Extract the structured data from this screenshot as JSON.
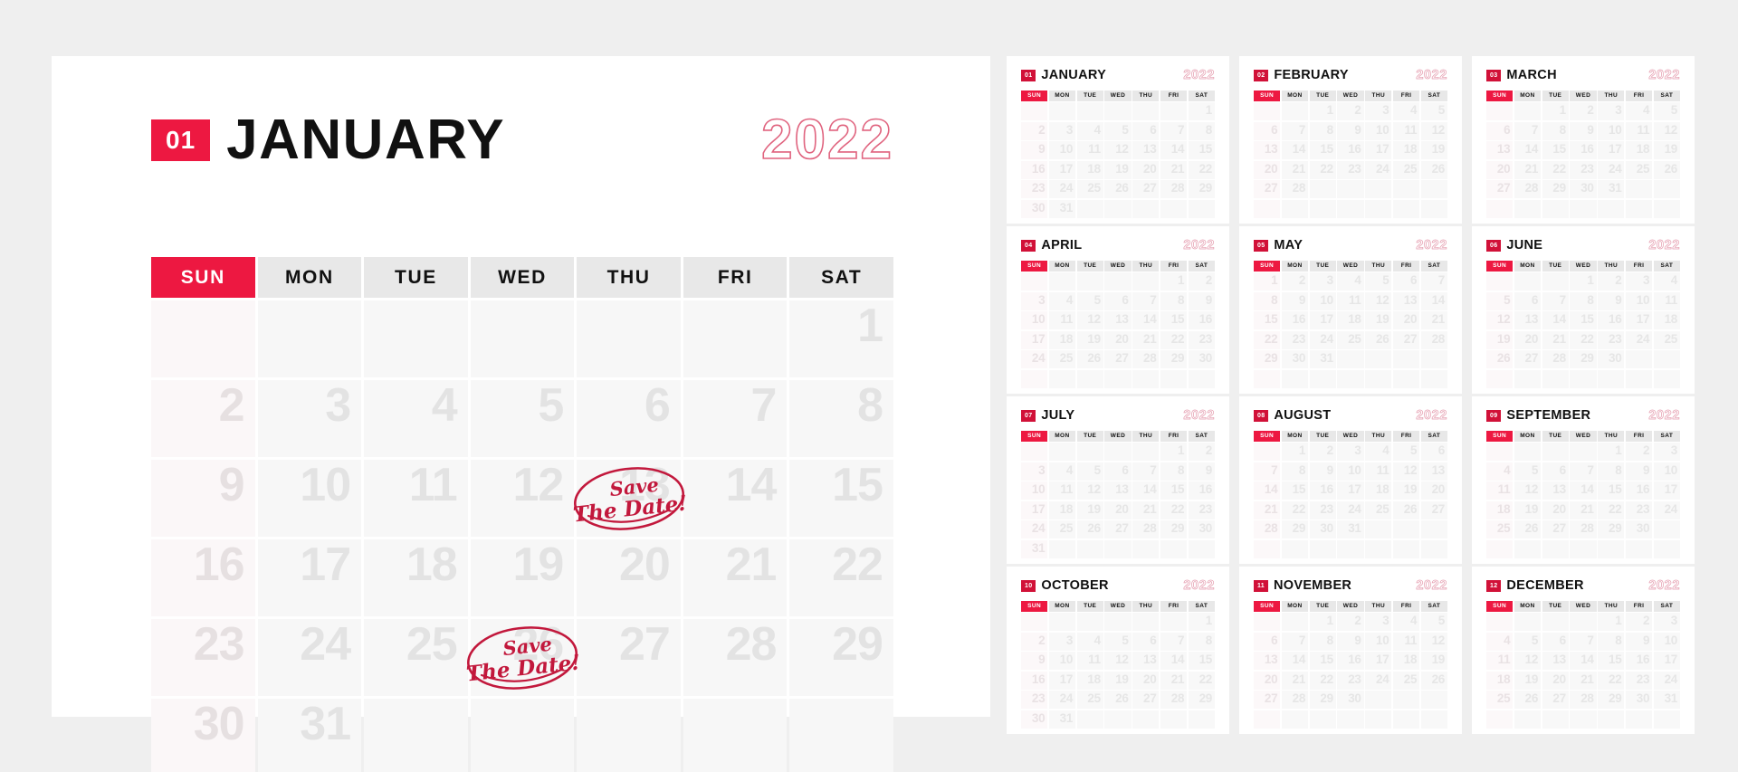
{
  "theme": {
    "page_background": "#efefef",
    "card_background": "#ffffff",
    "accent_red": "#ed1841",
    "badge_red": "#d11138",
    "stamp_red": "#c2183c",
    "day_number_gray": "#e3e3e3",
    "dow_background": "#e8e8e8",
    "cell_background": "#f7f7f7"
  },
  "year": "2022",
  "weekdays": [
    "SUN",
    "MON",
    "TUE",
    "WED",
    "THU",
    "FRI",
    "SAT"
  ],
  "main": {
    "month_number": "01",
    "month_name": "JANUARY",
    "year": "2022",
    "weekdays": [
      "SUN",
      "MON",
      "TUE",
      "WED",
      "THU",
      "FRI",
      "SAT"
    ],
    "start_weekday_index": 6,
    "days_in_month": 31,
    "weeks": [
      [
        "",
        "",
        "",
        "",
        "",
        "",
        "1"
      ],
      [
        "2",
        "3",
        "4",
        "5",
        "6",
        "7",
        "8"
      ],
      [
        "9",
        "10",
        "11",
        "12",
        "13",
        "14",
        "15"
      ],
      [
        "16",
        "17",
        "18",
        "19",
        "20",
        "21",
        "22"
      ],
      [
        "23",
        "24",
        "25",
        "26",
        "27",
        "28",
        "29"
      ],
      [
        "30",
        "31",
        "",
        "",
        "",
        "",
        ""
      ]
    ],
    "stamps": [
      {
        "line1": "Save",
        "line2": "The Date!",
        "week_index": 2,
        "day_index": 4,
        "day": "13"
      },
      {
        "line1": "Save",
        "line2": "The Date!",
        "week_index": 4,
        "day_index": 3,
        "day": "26"
      }
    ]
  },
  "mini_calendars": [
    {
      "month_number": "01",
      "month_name": "JANUARY",
      "year": "2022",
      "weeks": [
        [
          "",
          "",
          "",
          "",
          "",
          "",
          "1"
        ],
        [
          "2",
          "3",
          "4",
          "5",
          "6",
          "7",
          "8"
        ],
        [
          "9",
          "10",
          "11",
          "12",
          "13",
          "14",
          "15"
        ],
        [
          "16",
          "17",
          "18",
          "19",
          "20",
          "21",
          "22"
        ],
        [
          "23",
          "24",
          "25",
          "26",
          "27",
          "28",
          "29"
        ],
        [
          "30",
          "31",
          "",
          "",
          "",
          "",
          ""
        ]
      ]
    },
    {
      "month_number": "02",
      "month_name": "FEBRUARY",
      "year": "2022",
      "weeks": [
        [
          "",
          "",
          "1",
          "2",
          "3",
          "4",
          "5"
        ],
        [
          "6",
          "7",
          "8",
          "9",
          "10",
          "11",
          "12"
        ],
        [
          "13",
          "14",
          "15",
          "16",
          "17",
          "18",
          "19"
        ],
        [
          "20",
          "21",
          "22",
          "23",
          "24",
          "25",
          "26"
        ],
        [
          "27",
          "28",
          "",
          "",
          "",
          "",
          ""
        ],
        [
          "",
          "",
          "",
          "",
          "",
          "",
          ""
        ]
      ]
    },
    {
      "month_number": "03",
      "month_name": "MARCH",
      "year": "2022",
      "weeks": [
        [
          "",
          "",
          "1",
          "2",
          "3",
          "4",
          "5"
        ],
        [
          "6",
          "7",
          "8",
          "9",
          "10",
          "11",
          "12"
        ],
        [
          "13",
          "14",
          "15",
          "16",
          "17",
          "18",
          "19"
        ],
        [
          "20",
          "21",
          "22",
          "23",
          "24",
          "25",
          "26"
        ],
        [
          "27",
          "28",
          "29",
          "30",
          "31",
          "",
          ""
        ],
        [
          "",
          "",
          "",
          "",
          "",
          "",
          ""
        ]
      ]
    },
    {
      "month_number": "04",
      "month_name": "APRIL",
      "year": "2022",
      "weeks": [
        [
          "",
          "",
          "",
          "",
          "",
          "1",
          "2"
        ],
        [
          "3",
          "4",
          "5",
          "6",
          "7",
          "8",
          "9"
        ],
        [
          "10",
          "11",
          "12",
          "13",
          "14",
          "15",
          "16"
        ],
        [
          "17",
          "18",
          "19",
          "20",
          "21",
          "22",
          "23"
        ],
        [
          "24",
          "25",
          "26",
          "27",
          "28",
          "29",
          "30"
        ],
        [
          "",
          "",
          "",
          "",
          "",
          "",
          ""
        ]
      ]
    },
    {
      "month_number": "05",
      "month_name": "MAY",
      "year": "2022",
      "weeks": [
        [
          "1",
          "2",
          "3",
          "4",
          "5",
          "6",
          "7"
        ],
        [
          "8",
          "9",
          "10",
          "11",
          "12",
          "13",
          "14"
        ],
        [
          "15",
          "16",
          "17",
          "18",
          "19",
          "20",
          "21"
        ],
        [
          "22",
          "23",
          "24",
          "25",
          "26",
          "27",
          "28"
        ],
        [
          "29",
          "30",
          "31",
          "",
          "",
          "",
          ""
        ],
        [
          "",
          "",
          "",
          "",
          "",
          "",
          ""
        ]
      ]
    },
    {
      "month_number": "06",
      "month_name": "JUNE",
      "year": "2022",
      "weeks": [
        [
          "",
          "",
          "",
          "1",
          "2",
          "3",
          "4"
        ],
        [
          "5",
          "6",
          "7",
          "8",
          "9",
          "10",
          "11"
        ],
        [
          "12",
          "13",
          "14",
          "15",
          "16",
          "17",
          "18"
        ],
        [
          "19",
          "20",
          "21",
          "22",
          "23",
          "24",
          "25"
        ],
        [
          "26",
          "27",
          "28",
          "29",
          "30",
          "",
          ""
        ],
        [
          "",
          "",
          "",
          "",
          "",
          "",
          ""
        ]
      ]
    },
    {
      "month_number": "07",
      "month_name": "JULY",
      "year": "2022",
      "weeks": [
        [
          "",
          "",
          "",
          "",
          "",
          "1",
          "2"
        ],
        [
          "3",
          "4",
          "5",
          "6",
          "7",
          "8",
          "9"
        ],
        [
          "10",
          "11",
          "12",
          "13",
          "14",
          "15",
          "16"
        ],
        [
          "17",
          "18",
          "19",
          "20",
          "21",
          "22",
          "23"
        ],
        [
          "24",
          "25",
          "26",
          "27",
          "28",
          "29",
          "30"
        ],
        [
          "31",
          "",
          "",
          "",
          "",
          "",
          ""
        ]
      ]
    },
    {
      "month_number": "08",
      "month_name": "AUGUST",
      "year": "2022",
      "weeks": [
        [
          "",
          "1",
          "2",
          "3",
          "4",
          "5",
          "6"
        ],
        [
          "7",
          "8",
          "9",
          "10",
          "11",
          "12",
          "13"
        ],
        [
          "14",
          "15",
          "16",
          "17",
          "18",
          "19",
          "20"
        ],
        [
          "21",
          "22",
          "23",
          "24",
          "25",
          "26",
          "27"
        ],
        [
          "28",
          "29",
          "30",
          "31",
          "",
          "",
          ""
        ],
        [
          "",
          "",
          "",
          "",
          "",
          "",
          ""
        ]
      ]
    },
    {
      "month_number": "09",
      "month_name": "SEPTEMBER",
      "year": "2022",
      "weeks": [
        [
          "",
          "",
          "",
          "",
          "1",
          "2",
          "3"
        ],
        [
          "4",
          "5",
          "6",
          "7",
          "8",
          "9",
          "10"
        ],
        [
          "11",
          "12",
          "13",
          "14",
          "15",
          "16",
          "17"
        ],
        [
          "18",
          "19",
          "20",
          "21",
          "22",
          "23",
          "24"
        ],
        [
          "25",
          "26",
          "27",
          "28",
          "29",
          "30",
          ""
        ],
        [
          "",
          "",
          "",
          "",
          "",
          "",
          ""
        ]
      ]
    },
    {
      "month_number": "10",
      "month_name": "OCTOBER",
      "year": "2022",
      "weeks": [
        [
          "",
          "",
          "",
          "",
          "",
          "",
          "1"
        ],
        [
          "2",
          "3",
          "4",
          "5",
          "6",
          "7",
          "8"
        ],
        [
          "9",
          "10",
          "11",
          "12",
          "13",
          "14",
          "15"
        ],
        [
          "16",
          "17",
          "18",
          "19",
          "20",
          "21",
          "22"
        ],
        [
          "23",
          "24",
          "25",
          "26",
          "27",
          "28",
          "29"
        ],
        [
          "30",
          "31",
          "",
          "",
          "",
          "",
          ""
        ]
      ]
    },
    {
      "month_number": "11",
      "month_name": "NOVEMBER",
      "year": "2022",
      "weeks": [
        [
          "",
          "",
          "1",
          "2",
          "3",
          "4",
          "5"
        ],
        [
          "6",
          "7",
          "8",
          "9",
          "10",
          "11",
          "12"
        ],
        [
          "13",
          "14",
          "15",
          "16",
          "17",
          "18",
          "19"
        ],
        [
          "20",
          "21",
          "22",
          "23",
          "24",
          "25",
          "26"
        ],
        [
          "27",
          "28",
          "29",
          "30",
          "",
          "",
          ""
        ],
        [
          "",
          "",
          "",
          "",
          "",
          "",
          ""
        ]
      ]
    },
    {
      "month_number": "12",
      "month_name": "DECEMBER",
      "year": "2022",
      "weeks": [
        [
          "",
          "",
          "",
          "",
          "1",
          "2",
          "3"
        ],
        [
          "4",
          "5",
          "6",
          "7",
          "8",
          "9",
          "10"
        ],
        [
          "11",
          "12",
          "13",
          "14",
          "15",
          "16",
          "17"
        ],
        [
          "18",
          "19",
          "20",
          "21",
          "22",
          "23",
          "24"
        ],
        [
          "25",
          "26",
          "27",
          "28",
          "29",
          "30",
          "31"
        ],
        [
          "",
          "",
          "",
          "",
          "",
          "",
          ""
        ]
      ]
    }
  ]
}
